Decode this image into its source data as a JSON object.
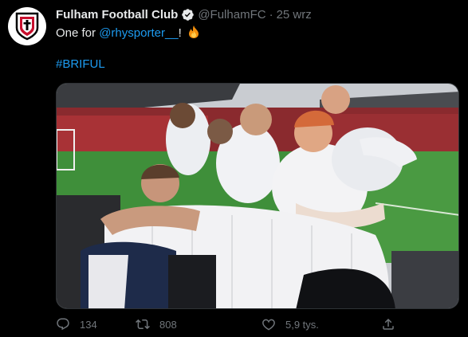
{
  "author": {
    "name": "Fulham Football Club",
    "handle": "@FulhamFC",
    "separator": "·",
    "date": "25 wrz"
  },
  "tweet": {
    "text_prefix": "One for ",
    "mention": "@rhysporter__",
    "text_suffix": "!",
    "emoji": "fire-emoji",
    "hashtag": "#BRIFUL"
  },
  "media": {
    "alt_subject": "players celebrating with a fan in the stands"
  },
  "actions": {
    "reply_count": "134",
    "retweet_count": "808",
    "like_count": "5,9 tys."
  },
  "colors": {
    "background": "#000000",
    "text": "#e7e9ea",
    "secondary": "#71767b",
    "accent": "#1d9bf0"
  },
  "icons": [
    "verified-badge-icon",
    "reply-icon",
    "retweet-icon",
    "like-icon",
    "share-icon"
  ]
}
